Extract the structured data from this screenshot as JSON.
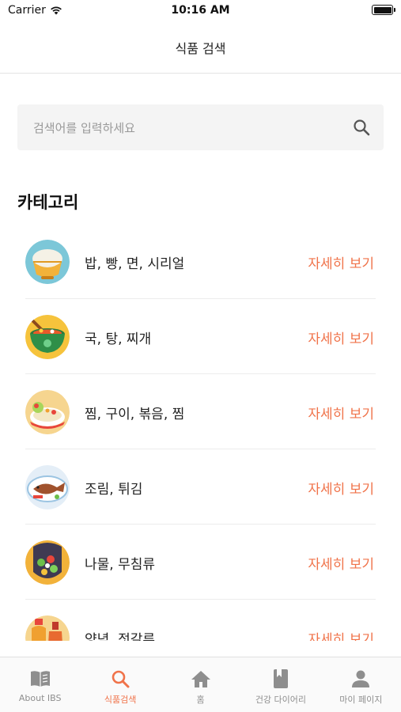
{
  "status_bar": {
    "carrier": "Carrier",
    "time": "10:16 AM"
  },
  "nav": {
    "title": "식품 검색"
  },
  "search": {
    "placeholder": "검색어를 입력하세요"
  },
  "section": {
    "title": "카테고리"
  },
  "categories": [
    {
      "label": "밥, 빵, 면, 시리얼",
      "action": "자세히 보기",
      "icon": "rice-bowl-icon"
    },
    {
      "label": "국, 탕, 찌개",
      "action": "자세히 보기",
      "icon": "soup-pot-icon"
    },
    {
      "label": "찜, 구이, 볶음, 찜",
      "action": "자세히 보기",
      "icon": "fried-dish-icon"
    },
    {
      "label": "조림, 튀김",
      "action": "자세히 보기",
      "icon": "grilled-fish-icon"
    },
    {
      "label": "나물, 무침류",
      "action": "자세히 보기",
      "icon": "vegetable-salad-icon"
    },
    {
      "label": "양념, 젓갈류",
      "action": "자세히 보기",
      "icon": "sauce-bottle-icon"
    }
  ],
  "tabs": [
    {
      "label": "About IBS",
      "icon": "book-icon",
      "active": false
    },
    {
      "label": "식품검색",
      "icon": "search-icon",
      "active": true
    },
    {
      "label": "홈",
      "icon": "home-icon",
      "active": false
    },
    {
      "label": "건강 다이어리",
      "icon": "diary-icon",
      "active": false
    },
    {
      "label": "마이 페이지",
      "icon": "person-icon",
      "active": false
    }
  ],
  "colors": {
    "accent": "#f0734a",
    "inactive": "#8e8e8e"
  }
}
